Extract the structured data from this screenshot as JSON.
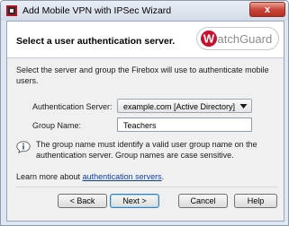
{
  "window": {
    "title": "Add Mobile VPN with IPSec Wizard",
    "close_glyph": "x",
    "icon": "wizard-app-icon"
  },
  "header": {
    "title": "Select a user authentication server.",
    "logo_text": "WatchGuard"
  },
  "body": {
    "intro": "Select the server and group the Firebox will use to authenticate mobile users.",
    "auth_server": {
      "label": "Authentication Server:",
      "value": "example.com [Active Directory]"
    },
    "group_name": {
      "label": "Group Name:",
      "value": "Teachers"
    },
    "note": "The group name must identify a valid user group name on the authentication server. Group names are case sensitive.",
    "learn_more": {
      "prefix": "Learn more about",
      "link": "authentication servers",
      "suffix": "."
    }
  },
  "buttons": {
    "back": "< Back",
    "next": "Next >",
    "cancel": "Cancel",
    "help": "Help"
  },
  "colors": {
    "logo_red": "#c8102e",
    "link": "#0f3ea8",
    "close_red": "#c9473a"
  }
}
